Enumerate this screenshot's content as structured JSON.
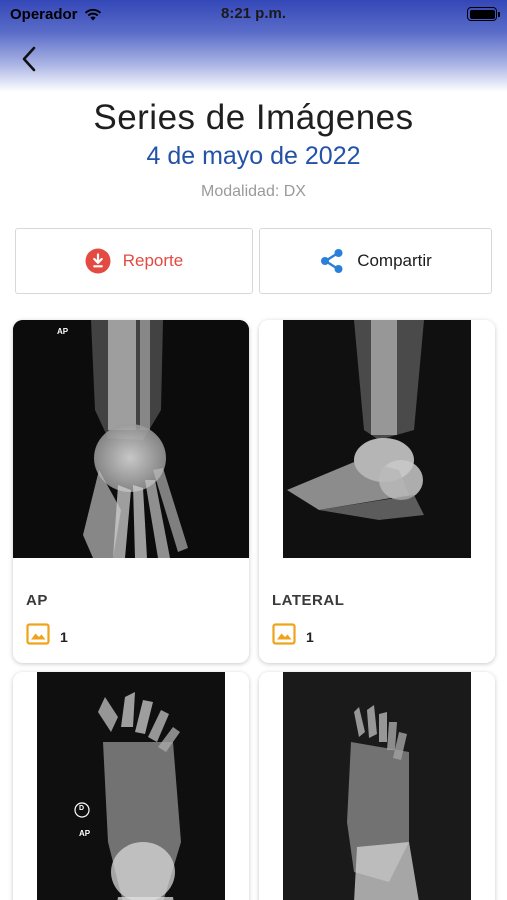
{
  "status_bar": {
    "carrier": "Operador",
    "time": "8:21 p.m."
  },
  "header": {
    "title": "Series de Imágenes",
    "date": "4 de mayo de 2022",
    "modality": "Modalidad: DX"
  },
  "actions": {
    "report_label": "Reporte",
    "share_label": "Compartir"
  },
  "series": [
    {
      "name": "AP",
      "count": "1",
      "overlay_labels": [
        "AP"
      ]
    },
    {
      "name": "LATERAL",
      "count": "1",
      "overlay_labels": []
    },
    {
      "name": "",
      "count": "",
      "overlay_labels": [
        "D",
        "AP"
      ]
    },
    {
      "name": "",
      "count": "",
      "overlay_labels": []
    }
  ],
  "colors": {
    "header_gradient_top": "#3447b8",
    "date_blue": "#2352a8",
    "report_red": "#e24a42",
    "share_blue": "#2a7fd8",
    "count_icon_orange": "#f0a21a"
  },
  "icons": {
    "back": "chevron-left-icon",
    "report": "download-circle-icon",
    "share": "share-icon",
    "image_count": "image-icon"
  }
}
